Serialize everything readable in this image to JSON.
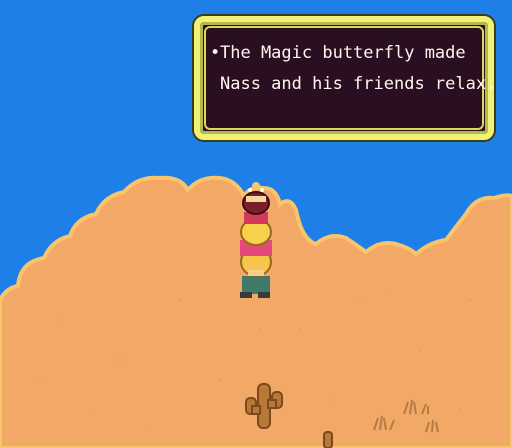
{
  "dialog": {
    "bullet": "•",
    "line1": "The Magic butterfly made",
    "line2": "Nass and his friends relax."
  },
  "scene": {
    "sky_color": "#1f7fe8",
    "sand_color": "#f2a866",
    "sand_highlight_color": "#f7c17d",
    "characters": [
      "party-leader",
      "party-member-2",
      "party-member-3"
    ],
    "props": [
      "cactus",
      "dry-bush",
      "dry-bush",
      "dry-bush",
      "small-cactus"
    ]
  }
}
